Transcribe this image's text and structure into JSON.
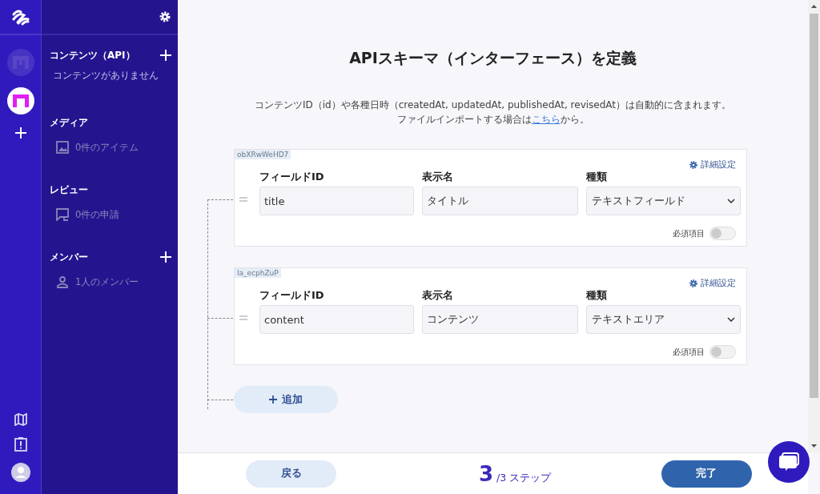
{
  "rail": {
    "apps": [
      {
        "kind": "faded",
        "selected": false
      },
      {
        "kind": "bright",
        "selected": true
      }
    ]
  },
  "sidebar": {
    "sections": [
      {
        "title": "コンテンツ（API）",
        "has_add": true,
        "items": [
          {
            "kind": "empty",
            "label": "コンテンツがありません"
          }
        ]
      },
      {
        "title": "メディア",
        "has_add": false,
        "items": [
          {
            "kind": "media",
            "label": "0件のアイテム"
          }
        ]
      },
      {
        "title": "レビュー",
        "has_add": false,
        "items": [
          {
            "kind": "review",
            "label": "0件の申請"
          }
        ]
      },
      {
        "title": "メンバー",
        "has_add": true,
        "items": [
          {
            "kind": "member",
            "label": "1人のメンバー"
          }
        ]
      }
    ]
  },
  "page": {
    "title": "APIスキーマ（インターフェース）を定義",
    "description": "コンテンツID（id）や各種日時（createdAt, updatedAt, publishedAt, revisedAt）は自動的に含まれます。",
    "import_before": "ファイルインポートする場合は",
    "import_link": "こちら",
    "import_after": "から。"
  },
  "fields": [
    {
      "tag": "obXRwWeHD7",
      "detail": "詳細設定",
      "id_label": "フィールドID",
      "id_value": "title",
      "name_label": "表示名",
      "name_value": "タイトル",
      "type_label": "種類",
      "type_value": "テキストフィールド",
      "required_label": "必須項目",
      "required": false
    },
    {
      "tag": "la_ecphZuP",
      "detail": "詳細設定",
      "id_label": "フィールドID",
      "id_value": "content",
      "name_label": "表示名",
      "name_value": "コンテンツ",
      "type_label": "種類",
      "type_value": "テキストエリア",
      "required_label": "必須項目",
      "required": false
    }
  ],
  "add_button": "追加",
  "footer": {
    "back": "戻る",
    "step": "3",
    "step_total": "/3 ステップ",
    "done": "完了"
  }
}
